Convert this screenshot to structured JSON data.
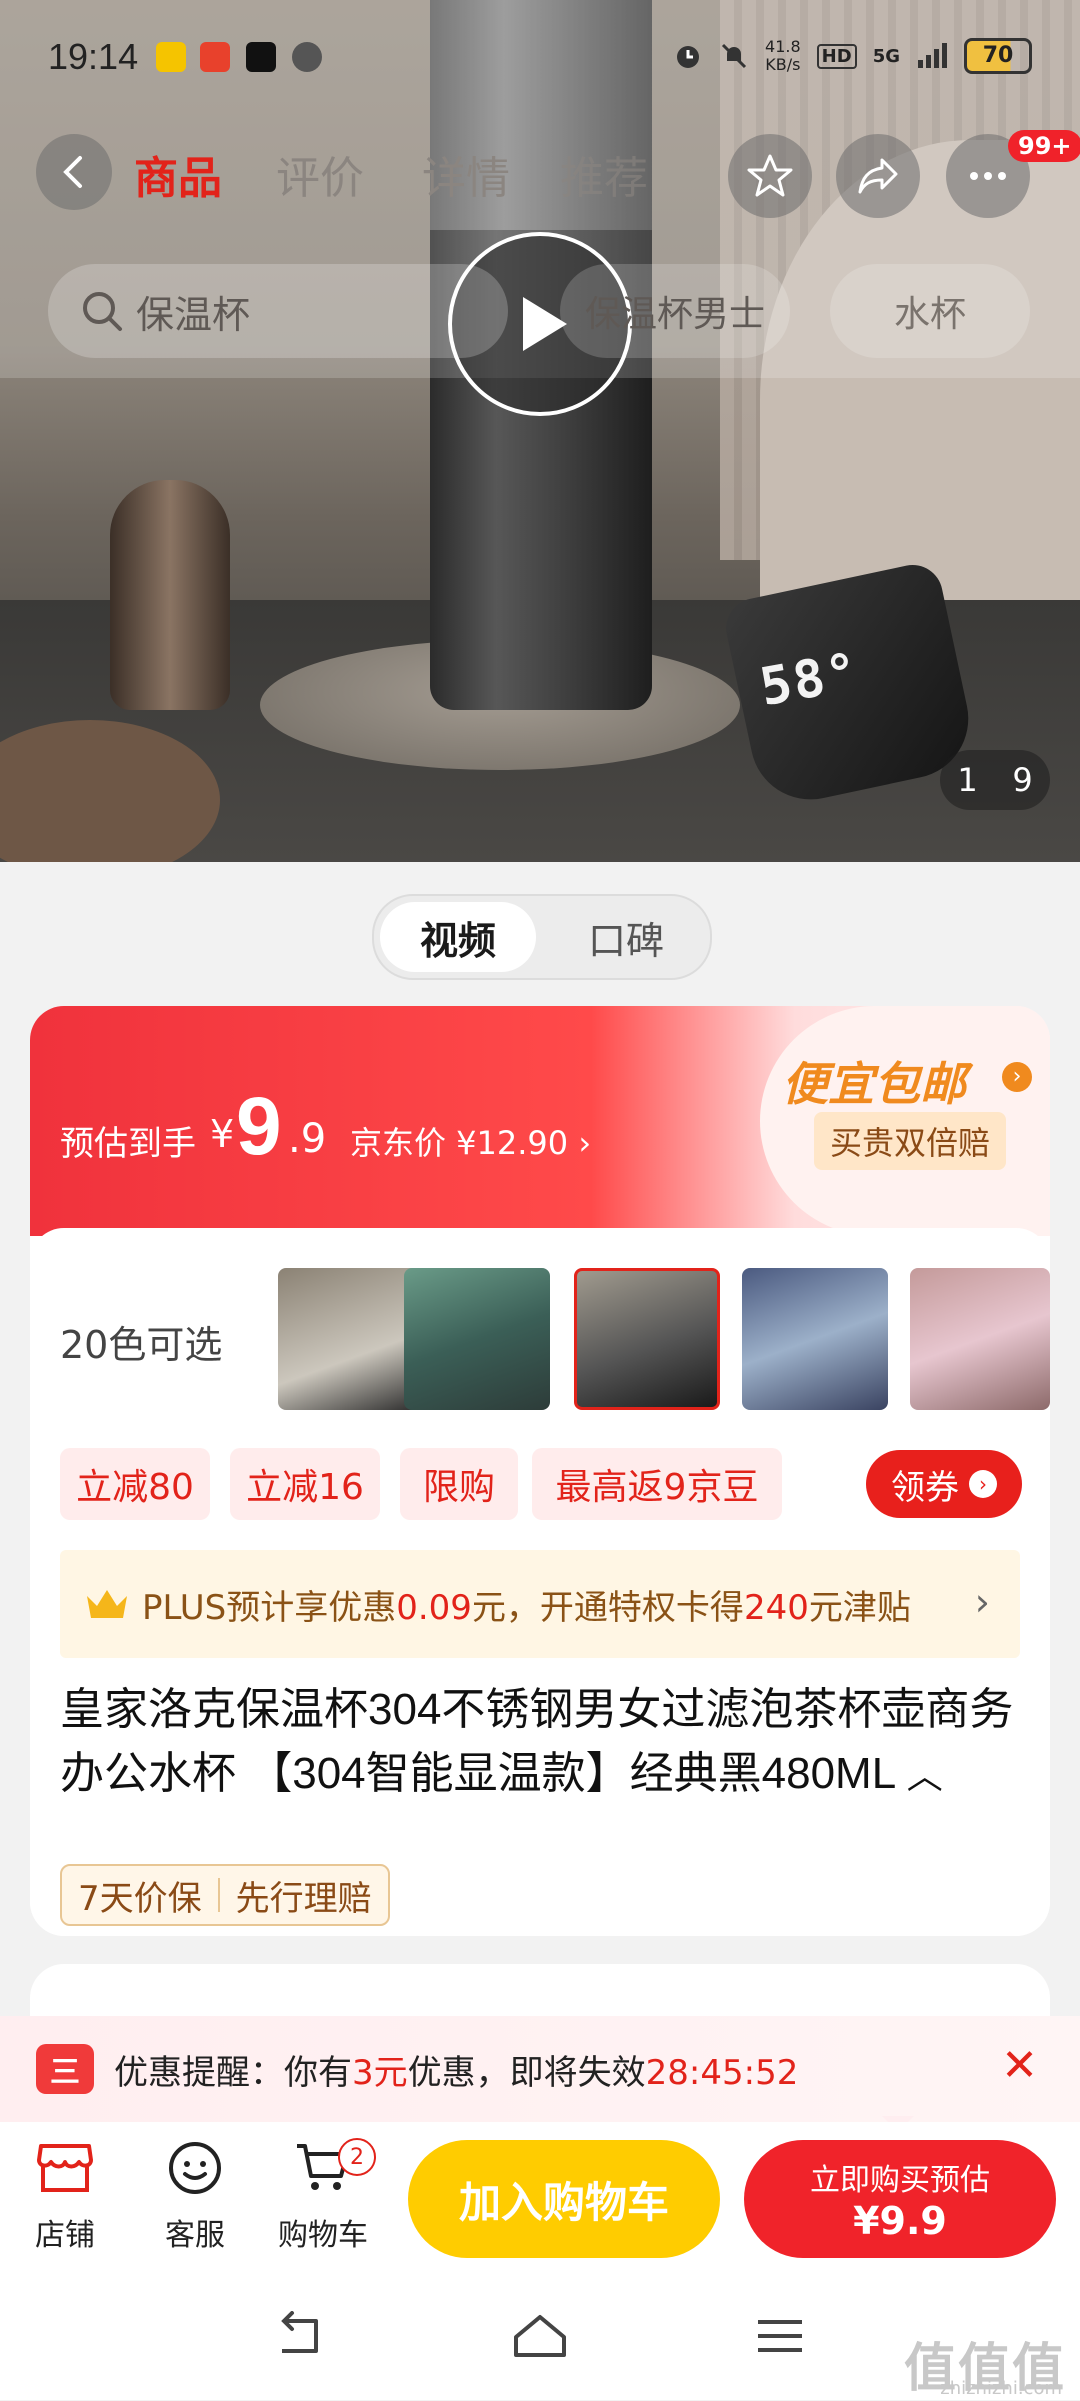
{
  "status_bar": {
    "time": "19:14",
    "net_speed": "41.8",
    "net_unit": "KB/s",
    "hd": "HD",
    "signal": "5G",
    "battery": "70"
  },
  "top_nav": {
    "tabs": [
      "商品",
      "评价",
      "详情",
      "推荐"
    ],
    "active_tab": "商品",
    "cart_badge": "99+"
  },
  "search": {
    "query": "保温杯",
    "suggestions": [
      "保温杯男士",
      "水杯"
    ]
  },
  "gallery": {
    "current_page": "1",
    "total_pages": "9",
    "temp_display": "58°"
  },
  "media_toggle": {
    "options": [
      "视频",
      "口碑"
    ],
    "active": "视频"
  },
  "price": {
    "est_label": "预估到手",
    "currency": "¥",
    "est_integer": "9",
    "est_decimal": ".9",
    "jd_price_label": "京东价 ¥12.90",
    "cheap_title": "便宜包邮",
    "cheap_sub": "买贵双倍赔"
  },
  "colors": {
    "label": "20色可选"
  },
  "coupons": {
    "items": [
      "立减80",
      "立减16",
      "限购",
      "最高返9京豆"
    ],
    "get_label": "领券"
  },
  "plus": {
    "prefix": "PLUS预计享优惠",
    "discount": "0.09",
    "mid": "元，开通特权卡得",
    "amount": "240",
    "suffix": "元津贴"
  },
  "product": {
    "title": "皇家洛克保温杯304不锈钢男女过滤泡茶杯壶商务办公水杯 【304智能显温款】经典黑480ML",
    "badges": [
      "7天价保",
      "先行理赔"
    ]
  },
  "reminder": {
    "icon_text": "三",
    "prefix": "优惠提醒：你有",
    "amount": "3元",
    "mid": "优惠，即将失效",
    "countdown": "28:45:52"
  },
  "action_bar": {
    "shop": "店铺",
    "service": "客服",
    "cart": "购物车",
    "cart_count": "2",
    "add_cart": "加入购物车",
    "buy_label": "立即购买预估",
    "buy_price": "¥9.9"
  },
  "watermark": {
    "main": "值值值",
    "sub": "zhizhizhi.com"
  },
  "colors_theme": {
    "jd_red": "#e2231a",
    "yellow": "#ffcc00"
  }
}
